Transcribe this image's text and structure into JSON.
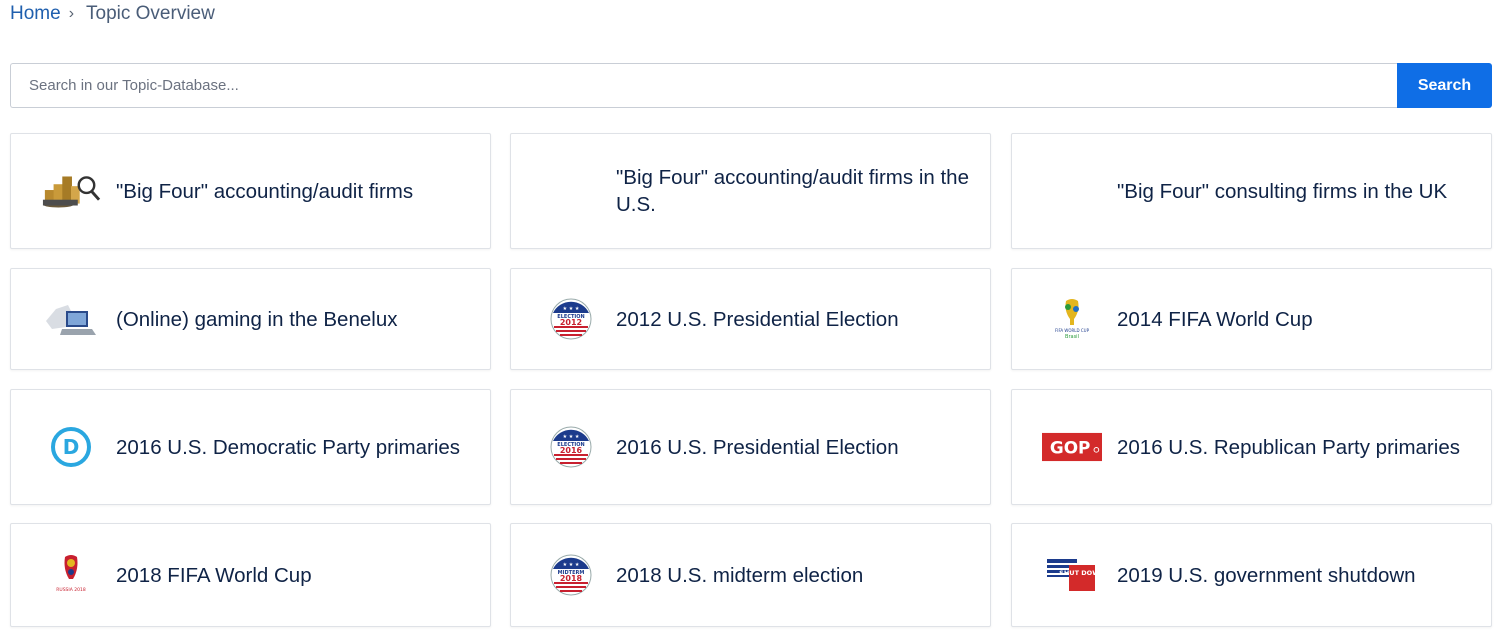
{
  "breadcrumb": {
    "home": "Home",
    "separator": "›",
    "current": "Topic Overview"
  },
  "search": {
    "placeholder": "Search in our Topic-Database...",
    "button_label": "Search"
  },
  "topics": [
    {
      "label": "\"Big Four\" accounting/audit firms",
      "icon": "coins-magnifier-icon"
    },
    {
      "label": "\"Big Four\" accounting/audit firms in the U.S.",
      "icon": ""
    },
    {
      "label": "\"Big Four\" consulting firms in the UK",
      "icon": ""
    },
    {
      "label": "(Online) gaming in the Benelux",
      "icon": "laptop-map-icon"
    },
    {
      "label": "2012 U.S. Presidential Election",
      "icon": "election-2012-badge-icon",
      "badge_top": "ELECTION",
      "badge_year": "2012"
    },
    {
      "label": "2014 FIFA World Cup",
      "icon": "fifa-world-cup-2014-icon",
      "logo_text": "FIFA WORLD CUP",
      "logo_sub": "Brasil"
    },
    {
      "label": "2016 U.S. Democratic Party primaries",
      "icon": "democratic-party-logo-icon",
      "logo_text": "D"
    },
    {
      "label": "2016 U.S. Presidential Election",
      "icon": "election-2016-badge-icon",
      "badge_top": "ELECTION",
      "badge_year": "2016"
    },
    {
      "label": "2016 U.S. Republican Party primaries",
      "icon": "gop-logo-icon",
      "logo_text": "GOP"
    },
    {
      "label": "2018 FIFA World Cup",
      "icon": "fifa-world-cup-2018-icon",
      "logo_sub": "RUSSIA 2018"
    },
    {
      "label": "2018 U.S. midterm election",
      "icon": "midterm-2018-badge-icon",
      "badge_top": "MIDTERM",
      "badge_year": "2018"
    },
    {
      "label": "2019 U.S. government shutdown",
      "icon": "shutdown-sign-icon",
      "logo_text": "SHUT DOWN"
    }
  ],
  "colors": {
    "link": "#1f5fae",
    "button": "#0f6ee6",
    "text": "#0f2346",
    "badge_red": "#c8202f",
    "badge_blue": "#1c3b8c",
    "democrat_blue": "#2aa7e0",
    "gop_red": "#d32a2a"
  }
}
